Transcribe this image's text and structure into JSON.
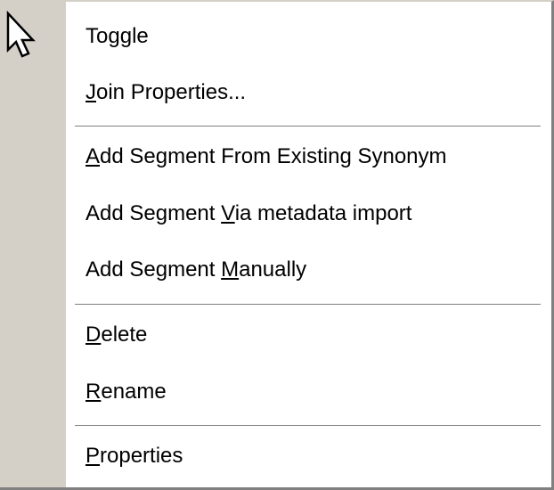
{
  "menu": {
    "items": [
      {
        "id": "toggle",
        "label": "Toggle",
        "mnemonic_index": 3
      },
      {
        "id": "join-properties",
        "label": "Join Properties...",
        "mnemonic_index": 0
      },
      {
        "separator": true
      },
      {
        "id": "add-segment-existing-synonym",
        "label": "Add Segment From Existing Synonym",
        "mnemonic_index": 0
      },
      {
        "id": "add-segment-via-metadata-import",
        "label": "Add Segment Via metadata import",
        "mnemonic_index": 12
      },
      {
        "id": "add-segment-manually",
        "label": "Add Segment Manually",
        "mnemonic_index": 12
      },
      {
        "separator": true
      },
      {
        "id": "delete",
        "label": "Delete",
        "mnemonic_index": 0
      },
      {
        "id": "rename",
        "label": "Rename",
        "mnemonic_index": 0
      },
      {
        "separator": true
      },
      {
        "id": "properties",
        "label": "Properties",
        "mnemonic_index": 0
      }
    ]
  },
  "colors": {
    "gutter": "#d4d0c8",
    "menu_background": "#ffffff",
    "separator": "#808080",
    "text": "#000000"
  },
  "cursor": {
    "icon": "arrow-pointer-icon"
  }
}
